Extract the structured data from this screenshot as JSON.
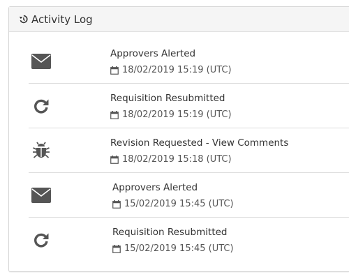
{
  "header": {
    "title": "Activity Log",
    "icon": "history-icon"
  },
  "log": {
    "items": [
      {
        "icon": "envelope-icon",
        "title": "Approvers Alerted",
        "date": "18/02/2019 15:19 (UTC)"
      },
      {
        "icon": "refresh-icon",
        "title": "Requisition Resubmitted",
        "date": "18/02/2019 15:19 (UTC)"
      },
      {
        "icon": "bug-icon",
        "title": "Revision Requested - View Comments",
        "date": "18/02/2019 15:18 (UTC)"
      },
      {
        "icon": "envelope-icon",
        "title": "Approvers Alerted",
        "date": "15/02/2019 15:45 (UTC)"
      },
      {
        "icon": "refresh-icon",
        "title": "Requisition Resubmitted",
        "date": "15/02/2019 15:45 (UTC)"
      }
    ]
  },
  "colors": {
    "icon": "#555555",
    "header_bg": "#f5f5f5",
    "border": "#dddddd",
    "text": "#333333"
  }
}
